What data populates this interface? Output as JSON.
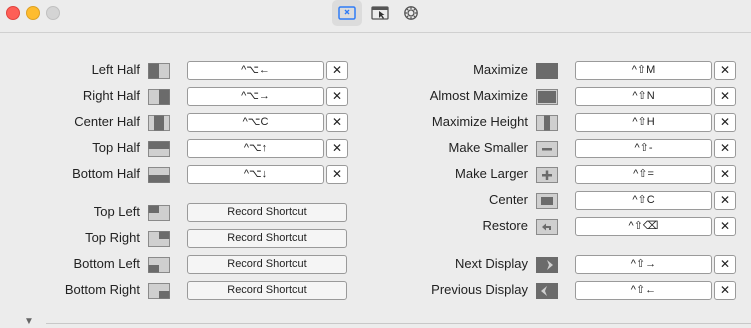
{
  "toolbar": {
    "tabs": [
      {
        "name": "keyboard-shortcuts-tab",
        "icon": "keyboard-shortcuts-icon",
        "active": true
      },
      {
        "name": "snap-areas-tab",
        "icon": "snap-areas-icon",
        "active": false
      },
      {
        "name": "settings-tab",
        "icon": "gear-icon",
        "active": false
      }
    ]
  },
  "left": [
    {
      "label": "Left Half",
      "shortcut": "^⌥←",
      "icon": "left-half-icon"
    },
    {
      "label": "Right Half",
      "shortcut": "^⌥→",
      "icon": "right-half-icon"
    },
    {
      "label": "Center Half",
      "shortcut": "^⌥C",
      "icon": "center-half-icon"
    },
    {
      "label": "Top Half",
      "shortcut": "^⌥↑",
      "icon": "top-half-icon"
    },
    {
      "label": "Bottom Half",
      "shortcut": "^⌥↓",
      "icon": "bottom-half-icon"
    },
    {
      "label": "Top Left",
      "record": "Record Shortcut",
      "icon": "top-left-icon"
    },
    {
      "label": "Top Right",
      "record": "Record Shortcut",
      "icon": "top-right-icon"
    },
    {
      "label": "Bottom Left",
      "record": "Record Shortcut",
      "icon": "bottom-left-icon"
    },
    {
      "label": "Bottom Right",
      "record": "Record Shortcut",
      "icon": "bottom-right-icon"
    }
  ],
  "right": [
    {
      "label": "Maximize",
      "shortcut": "^⇧M",
      "icon": "maximize-icon"
    },
    {
      "label": "Almost Maximize",
      "shortcut": "^⇧N",
      "icon": "almost-maximize-icon"
    },
    {
      "label": "Maximize Height",
      "shortcut": "^⇧H",
      "icon": "maximize-height-icon"
    },
    {
      "label": "Make Smaller",
      "shortcut": "^⇧-",
      "icon": "make-smaller-icon"
    },
    {
      "label": "Make Larger",
      "shortcut": "^⇧=",
      "icon": "make-larger-icon"
    },
    {
      "label": "Center",
      "shortcut": "^⇧C",
      "icon": "center-icon"
    },
    {
      "label": "Restore",
      "shortcut": "^⇧⌫",
      "icon": "restore-icon"
    },
    {
      "label": "Next Display",
      "shortcut": "^⇧→",
      "icon": "next-display-icon"
    },
    {
      "label": "Previous Display",
      "shortcut": "^⇧←",
      "icon": "previous-display-icon"
    }
  ],
  "clear_glyph": "✕",
  "colors": {
    "icon_dark": "#6b6b6b",
    "icon_light": "#cfcfcf",
    "icon_border": "#8a8a8a"
  }
}
